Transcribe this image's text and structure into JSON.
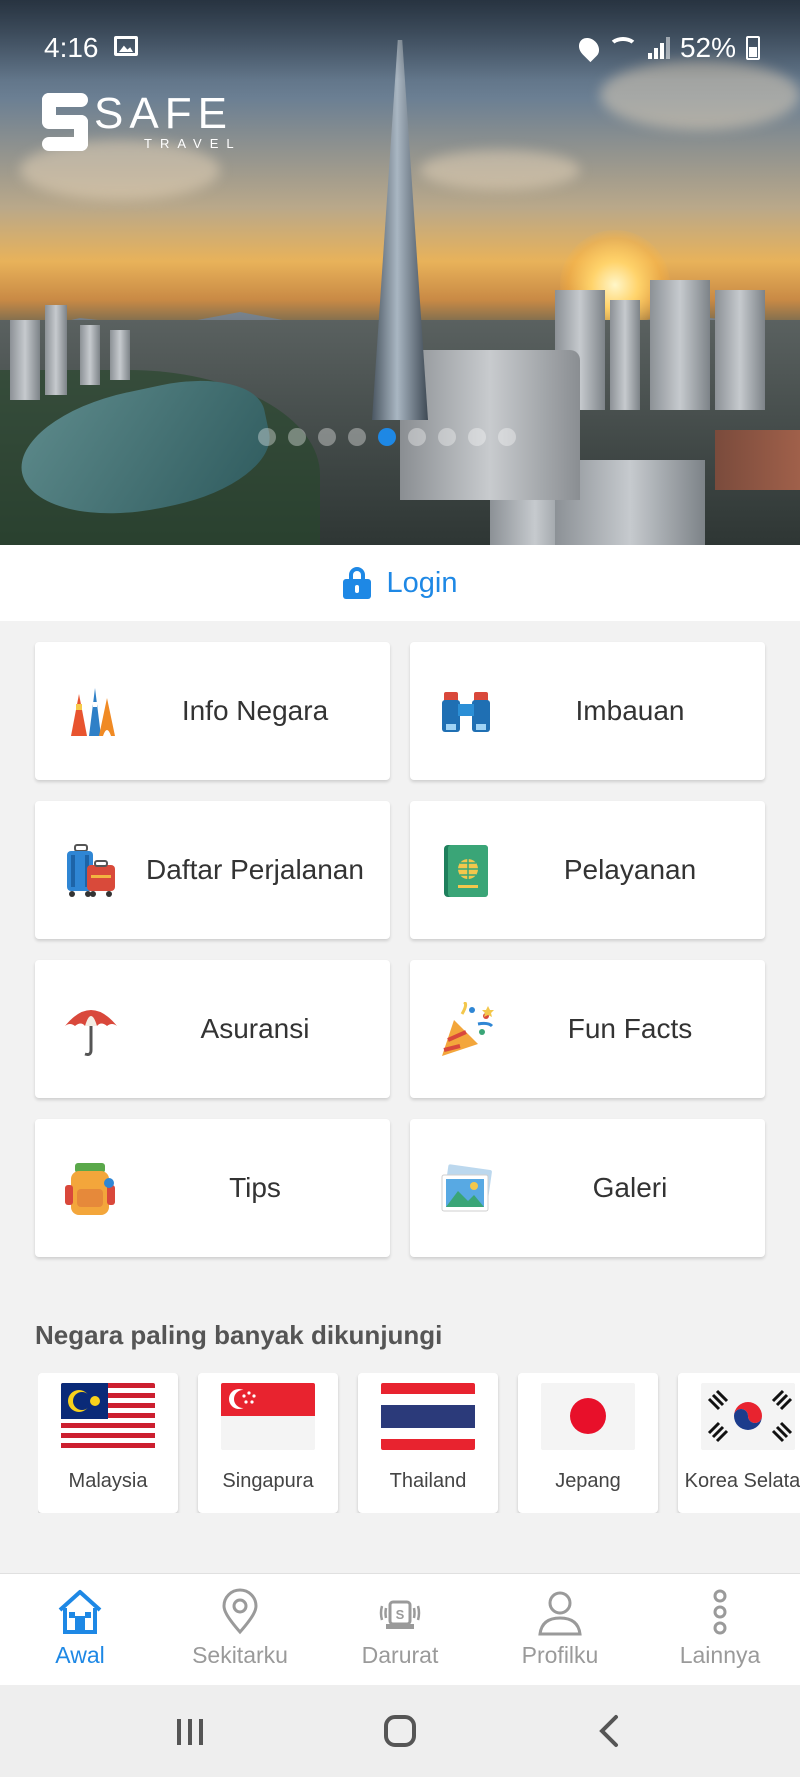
{
  "status_bar": {
    "time": "4:16",
    "battery": "52%",
    "icons": [
      "gallery-icon",
      "location-icon",
      "wifi-icon",
      "signal-icon",
      "battery-icon"
    ]
  },
  "banner": {
    "logo_main": "SAFE",
    "logo_sub": "TRAVEL",
    "slide_count": 9,
    "active_slide": 5
  },
  "login": {
    "label": "Login",
    "icon": "lock-icon"
  },
  "menu": [
    {
      "label": "Info Negara",
      "icon": "landmarks-icon"
    },
    {
      "label": "Imbauan",
      "icon": "binoculars-icon"
    },
    {
      "label": "Daftar Perjalanan",
      "icon": "luggage-icon"
    },
    {
      "label": "Pelayanan",
      "icon": "passport-icon"
    },
    {
      "label": "Asuransi",
      "icon": "umbrella-icon"
    },
    {
      "label": "Fun Facts",
      "icon": "party-popper-icon"
    },
    {
      "label": "Tips",
      "icon": "backpack-icon"
    },
    {
      "label": "Galeri",
      "icon": "photos-icon"
    }
  ],
  "popular": {
    "title": "Negara paling banyak dikunjungi",
    "countries": [
      {
        "name": "Malaysia",
        "flag": "malaysia-flag"
      },
      {
        "name": "Singapura",
        "flag": "singapore-flag"
      },
      {
        "name": "Thailand",
        "flag": "thailand-flag"
      },
      {
        "name": "Jepang",
        "flag": "japan-flag"
      },
      {
        "name": "Korea Selatan",
        "flag": "south-korea-flag"
      }
    ]
  },
  "bottom_nav": [
    {
      "label": "Awal",
      "icon": "home-icon",
      "active": true
    },
    {
      "label": "Sekitarku",
      "icon": "location-pin-icon",
      "active": false
    },
    {
      "label": "Darurat",
      "icon": "emergency-siren-icon",
      "active": false
    },
    {
      "label": "Profilku",
      "icon": "person-icon",
      "active": false
    },
    {
      "label": "Lainnya",
      "icon": "more-vertical-icon",
      "active": false
    }
  ],
  "colors": {
    "accent": "#1e88e5",
    "inactive": "#9a9a9a",
    "background": "#f2f2f2"
  }
}
